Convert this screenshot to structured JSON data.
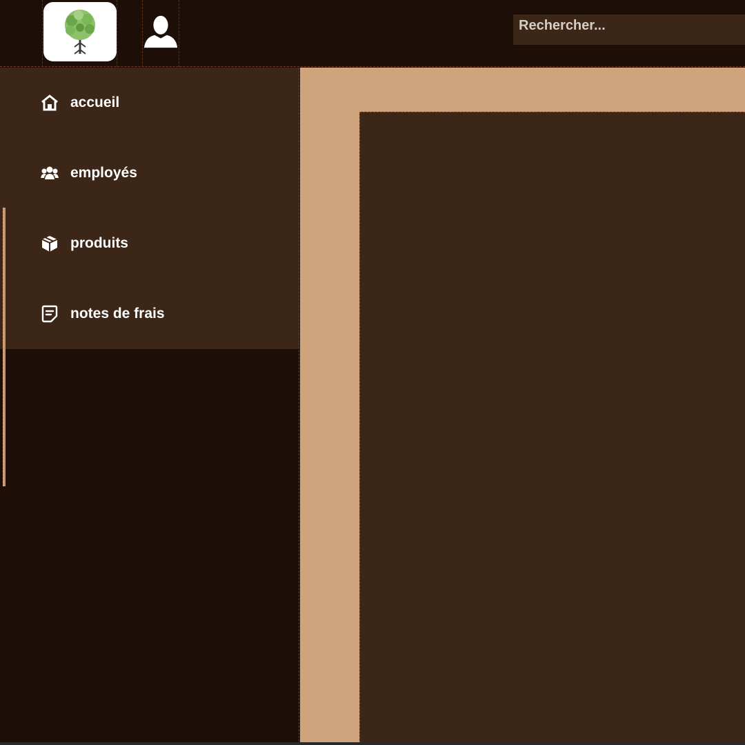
{
  "header": {
    "logo_icon": "tree-logo-icon",
    "user_icon": "user-icon",
    "search_placeholder": "Rechercher..."
  },
  "sidebar": {
    "items": [
      {
        "label": "accueil",
        "icon": "home-icon"
      },
      {
        "label": "employés",
        "icon": "users-icon"
      },
      {
        "label": "produits",
        "icon": "package-icon"
      },
      {
        "label": "notes de frais",
        "icon": "note-icon"
      }
    ]
  },
  "colors": {
    "background": "#1e0e08",
    "panel": "#3c2618",
    "accent": "#cfa47c",
    "text": "#ffffff"
  }
}
